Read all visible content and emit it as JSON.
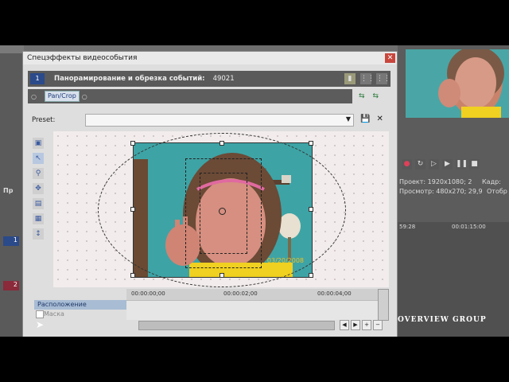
{
  "dialog": {
    "title": "Спецэффекты видеособытия",
    "close_symbol": "✕",
    "effect_icon_label": "1",
    "effect_title": "Панорамирование и обрезка событий:",
    "effect_number": "49021",
    "chain_item": "Pan/Crop",
    "preset_label": "Preset:",
    "preset_value": "",
    "timeline": {
      "ticks": [
        "00:00:00;00",
        "00:00:02;00",
        "00:00:04;00"
      ],
      "properties": [
        "Расположение",
        "Маска"
      ]
    }
  },
  "photo": {
    "date_stamp": "03/20/2008"
  },
  "background_app": {
    "info_lines": [
      "Проект: 1920x1080; 2",
      "Просмотр: 480x270; 29,9",
      "Кадр:",
      "Отобр"
    ],
    "timeline_times": [
      "59:28",
      "00:01:15:00"
    ],
    "left_label": "Пр",
    "track_numbers": [
      "1",
      "2"
    ],
    "watermark": "OVERVIEW GROUP"
  }
}
